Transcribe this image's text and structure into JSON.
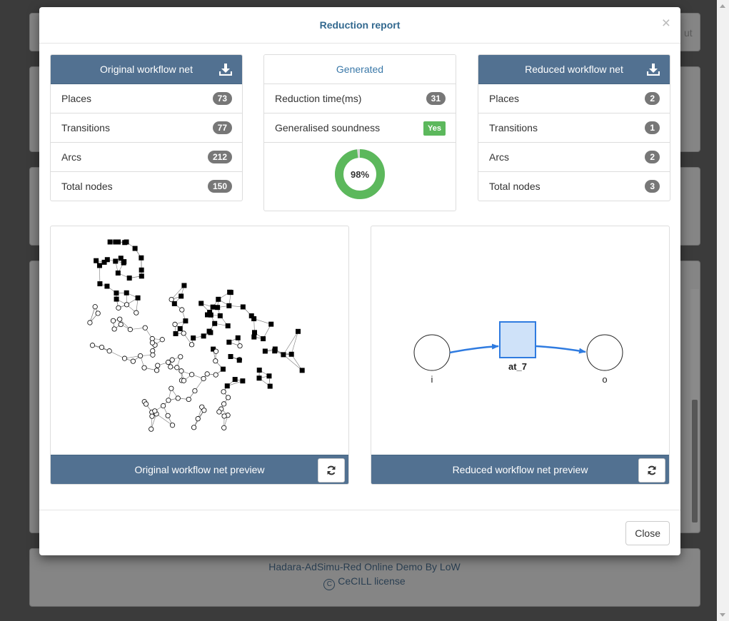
{
  "background": {
    "button_text_partial": "ut",
    "footer": {
      "line1": "Hadara-AdSimu-Red Online Demo By LoW",
      "line2": "CeCILL license"
    }
  },
  "modal": {
    "title": "Reduction report",
    "close_x": "×",
    "original": {
      "title": "Original workflow net",
      "icon": "download-icon",
      "rows": [
        {
          "label": "Places",
          "value": "73"
        },
        {
          "label": "Transitions",
          "value": "77"
        },
        {
          "label": "Arcs",
          "value": "212"
        },
        {
          "label": "Total nodes",
          "value": "150"
        }
      ]
    },
    "generated": {
      "title": "Generated",
      "reduction_time_label": "Reduction time(ms)",
      "reduction_time_value": "31",
      "soundness_label": "Generalised soundness",
      "soundness_value": "Yes",
      "donut_percent": 98,
      "donut_label": "98%",
      "colors": {
        "fill": "#5cb85c",
        "rest": "#d9d9d9"
      }
    },
    "reduced": {
      "title": "Reduced workflow net",
      "icon": "download-icon",
      "rows": [
        {
          "label": "Places",
          "value": "2"
        },
        {
          "label": "Transitions",
          "value": "1"
        },
        {
          "label": "Arcs",
          "value": "2"
        },
        {
          "label": "Total nodes",
          "value": "3"
        }
      ]
    },
    "original_preview": {
      "label": "Original workflow net preview",
      "icon": "refresh-icon"
    },
    "reduced_preview": {
      "label": "Reduced workflow net preview",
      "icon": "refresh-icon",
      "place_in": "i",
      "transition": "at_7",
      "place_out": "o",
      "colors": {
        "transition_fill": "#cfe2f9",
        "transition_stroke": "#2f7be0",
        "arc": "#2f7be0"
      }
    },
    "close_button": "Close"
  }
}
